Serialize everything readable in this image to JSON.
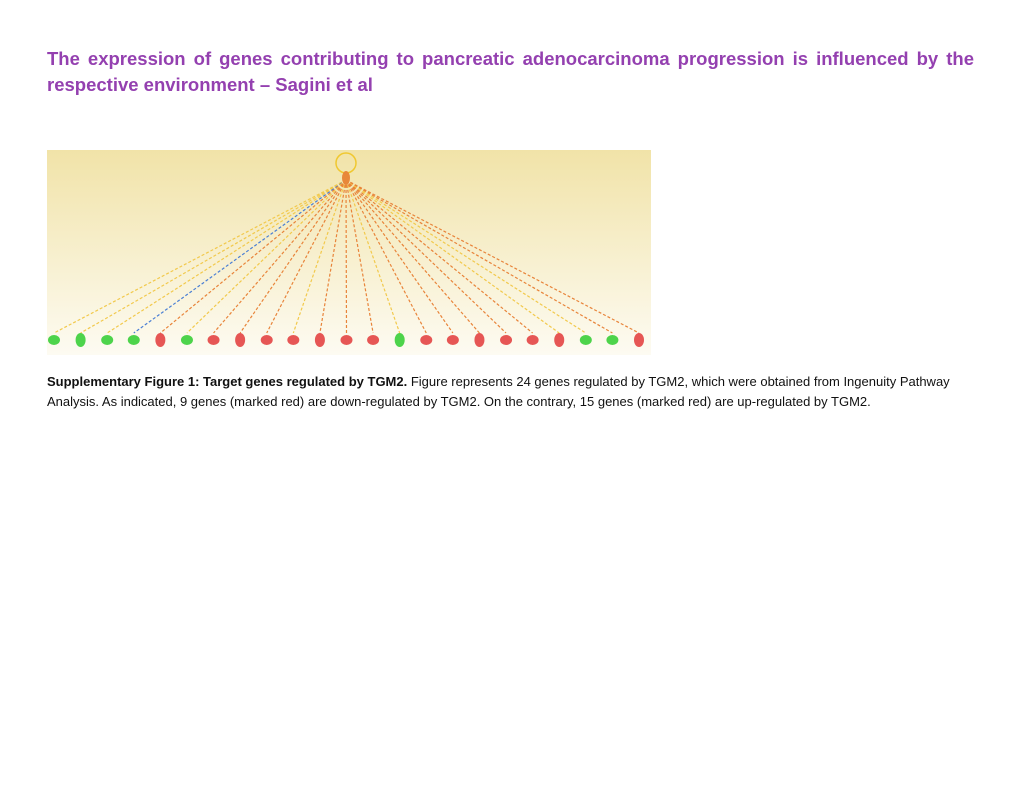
{
  "header": {
    "title": "The expression of genes contributing to pancreatic adenocarcinoma progression is influenced by the respective environment – Sagini et al"
  },
  "figure": {
    "colors": {
      "up": "#2ecc2e",
      "down": "#e23a3a",
      "hub": "#e8873a",
      "edge_yellow": "#f2c94c",
      "edge_orange": "#e8843a",
      "edge_blue": "#4a7fd4",
      "background_top": "#f1e3a8",
      "background_bottom": "#fdfbf2"
    },
    "nodes": [
      "up",
      "up",
      "up",
      "up",
      "down",
      "up",
      "down",
      "down",
      "down",
      "down",
      "down",
      "down",
      "down",
      "up",
      "down",
      "down",
      "down",
      "down",
      "down",
      "down",
      "up",
      "up",
      "down"
    ],
    "edges": [
      "yellow",
      "yellow",
      "yellow",
      "blue",
      "orange",
      "yellow",
      "orange",
      "orange",
      "orange",
      "yellow",
      "orange",
      "orange",
      "orange",
      "yellow",
      "orange",
      "orange",
      "orange",
      "orange",
      "orange",
      "yellow",
      "yellow",
      "orange",
      "orange"
    ]
  },
  "caption": {
    "label": "Supplementary Figure 1: Target genes regulated by TGM2.",
    "text": " Figure represents 24 genes regulated by TGM2, which were obtained from Ingenuity Pathway Analysis. As indicated, 9 genes (marked red) are down-regulated by TGM2. On the contrary, 15 genes (marked red) are up-regulated by TGM2."
  }
}
